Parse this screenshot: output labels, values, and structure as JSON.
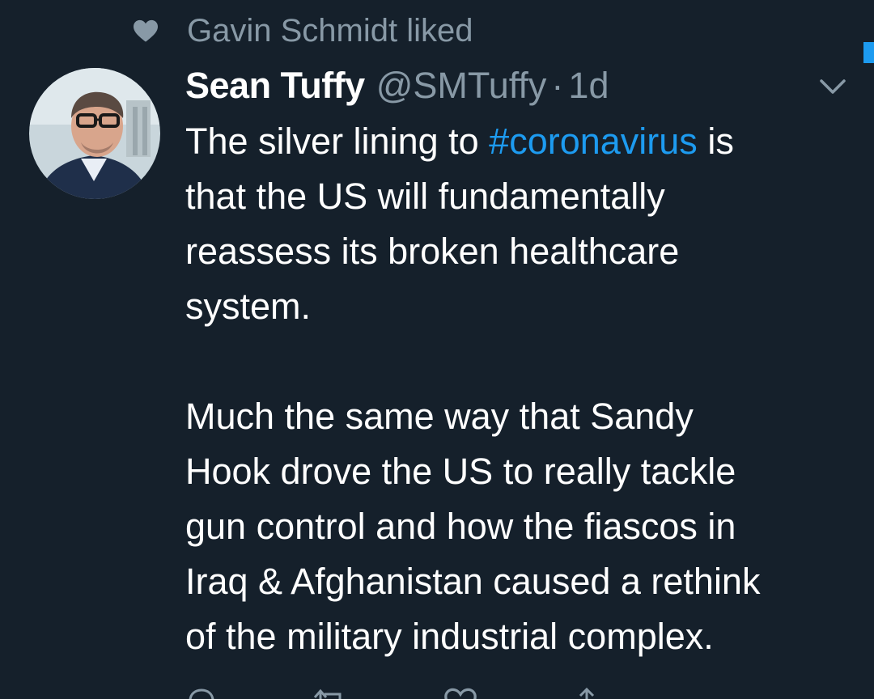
{
  "social_context": {
    "text": "Gavin Schmidt liked",
    "icon": "heart-icon"
  },
  "tweet": {
    "display_name": "Sean Tuffy",
    "handle": "@SMTuffy",
    "separator": "·",
    "timestamp": "1d",
    "menu_icon": "chevron-down-icon",
    "text_lines": {
      "l1_before": "The silver lining to ",
      "l1_hashtag": "#coronavirus",
      "l1_after": " is",
      "l2": "that the US will fundamentally",
      "l3": "reassess its broken healthcare",
      "l4": "system.",
      "l5": "Much the same way that Sandy",
      "l6": "Hook drove the US to really tackle",
      "l7": "gun control and how the fiascos in",
      "l8": "Iraq & Afghanistan caused a rethink",
      "l9": "of the military industrial complex."
    }
  },
  "actions": {
    "reply_icon": "reply-icon",
    "retweet_icon": "retweet-icon",
    "like_icon": "like-icon",
    "share_icon": "share-icon"
  },
  "colors": {
    "background": "#15202b",
    "text": "#ffffff",
    "secondary": "#8899a6",
    "accent": "#1d9bf0"
  }
}
